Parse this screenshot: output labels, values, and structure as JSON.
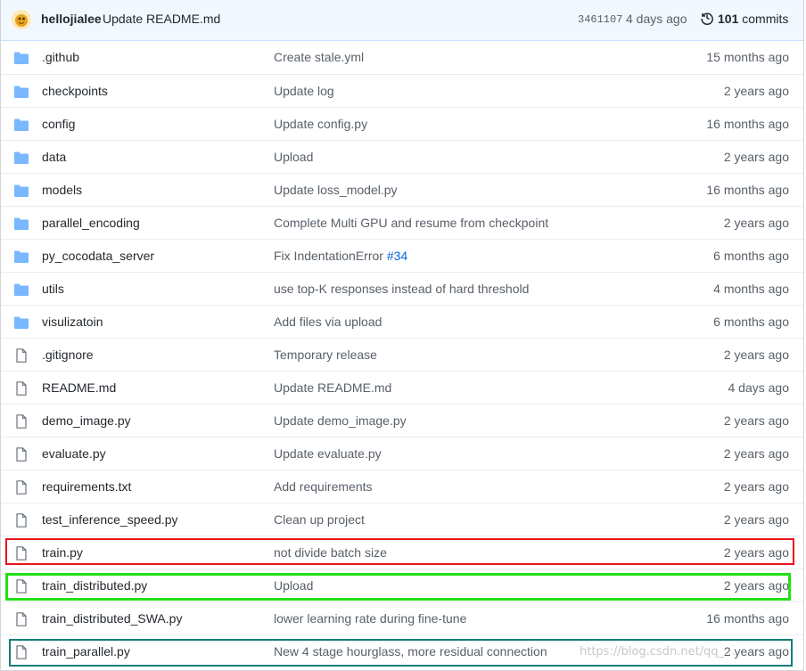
{
  "commit": {
    "author": "hellojialee",
    "message": "Update README.md",
    "sha": "3461107",
    "age": "4 days ago",
    "count": "101",
    "count_label": "commits"
  },
  "files": [
    {
      "type": "folder",
      "name": ".github",
      "message": "Create stale.yml",
      "age": "15 months ago"
    },
    {
      "type": "folder",
      "name": "checkpoints",
      "message": "Update log",
      "age": "2 years ago"
    },
    {
      "type": "folder",
      "name": "config",
      "message": "Update config.py",
      "age": "16 months ago"
    },
    {
      "type": "folder",
      "name": "data",
      "message": "Upload",
      "age": "2 years ago"
    },
    {
      "type": "folder",
      "name": "models",
      "message": "Update loss_model.py",
      "age": "16 months ago"
    },
    {
      "type": "folder",
      "name": "parallel_encoding",
      "message": "Complete Multi GPU and resume from checkpoint",
      "age": "2 years ago"
    },
    {
      "type": "folder",
      "name": "py_cocodata_server",
      "message": "Fix IndentationError",
      "issue": "#34",
      "age": "6 months ago"
    },
    {
      "type": "folder",
      "name": "utils",
      "message": "use top-K responses instead of hard threshold",
      "age": "4 months ago"
    },
    {
      "type": "folder",
      "name": "visulizatoin",
      "message": "Add files via upload",
      "age": "6 months ago"
    },
    {
      "type": "file",
      "name": ".gitignore",
      "message": "Temporary release",
      "age": "2 years ago"
    },
    {
      "type": "file",
      "name": "README.md",
      "message": "Update README.md",
      "age": "4 days ago"
    },
    {
      "type": "file",
      "name": "demo_image.py",
      "message": "Update demo_image.py",
      "age": "2 years ago"
    },
    {
      "type": "file",
      "name": "evaluate.py",
      "message": "Update evaluate.py",
      "age": "2 years ago"
    },
    {
      "type": "file",
      "name": "requirements.txt",
      "message": "Add requirements",
      "age": "2 years ago"
    },
    {
      "type": "file",
      "name": "test_inference_speed.py",
      "message": "Clean up project",
      "age": "2 years ago"
    },
    {
      "type": "file",
      "name": "train.py",
      "message": "not divide batch size",
      "age": "2 years ago"
    },
    {
      "type": "file",
      "name": "train_distributed.py",
      "message": "Upload",
      "age": "2 years ago"
    },
    {
      "type": "file",
      "name": "train_distributed_SWA.py",
      "message": "lower learning rate during fine-tune",
      "age": "16 months ago"
    },
    {
      "type": "file",
      "name": "train_parallel.py",
      "message": "New 4 stage hourglass, more residual connection",
      "age": "2 years ago"
    }
  ],
  "watermark": "https://blog.csdn.net/qq_...",
  "colors": {
    "folder": "#79b8ff",
    "highlight_red": "#e8141b",
    "highlight_green": "#22e014",
    "highlight_teal": "#127d78"
  }
}
